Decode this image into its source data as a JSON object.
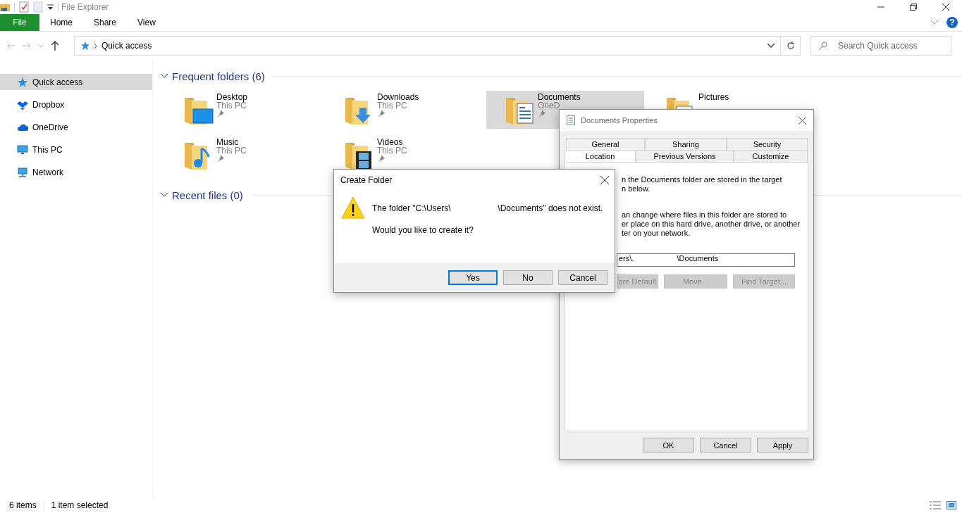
{
  "window": {
    "title": "File Explorer"
  },
  "ribbon": {
    "tabs": [
      {
        "label": "File",
        "kind": "file"
      },
      {
        "label": "Home",
        "kind": "tab"
      },
      {
        "label": "Share",
        "kind": "tab"
      },
      {
        "label": "View",
        "kind": "tab"
      }
    ],
    "help": "?"
  },
  "address": {
    "path": "Quick access"
  },
  "search": {
    "placeholder": "Search Quick access"
  },
  "sidebar": {
    "items": [
      {
        "label": "Quick access",
        "selected": true
      },
      {
        "label": "Dropbox",
        "selected": false
      },
      {
        "label": "OneDrive",
        "selected": false
      },
      {
        "label": "This PC",
        "selected": false
      },
      {
        "label": "Network",
        "selected": false
      }
    ]
  },
  "sections": [
    {
      "title": "Frequent folders (6)",
      "expanded": true,
      "items": [
        {
          "name": "Desktop",
          "location": "This PC",
          "pinned": true,
          "selected": false
        },
        {
          "name": "Downloads",
          "location": "This PC",
          "pinned": true,
          "selected": false
        },
        {
          "name": "Documents",
          "location": "OneD",
          "pinned": true,
          "selected": true
        },
        {
          "name": "Pictures",
          "selected": false
        },
        {
          "name": "Music",
          "location": "This PC",
          "pinned": true,
          "selected": false
        },
        {
          "name": "Videos",
          "location": "This PC",
          "pinned": true,
          "selected": false
        }
      ]
    },
    {
      "title": "Recent files (0)",
      "expanded": true
    }
  ],
  "status_bar": {
    "item_count": "6 items",
    "selection": "1 item selected"
  },
  "properties_dialog": {
    "title": "Documents Properties",
    "tab_rows": [
      [
        {
          "label": "General",
          "selected": false
        },
        {
          "label": "Sharing",
          "selected": false
        },
        {
          "label": "Security",
          "selected": false
        }
      ],
      [
        {
          "label": "Location",
          "selected": true
        },
        {
          "label": "Previous Versions",
          "selected": false
        },
        {
          "label": "Customize",
          "selected": false
        }
      ]
    ],
    "paragraphs": [
      [
        "n the Documents folder are stored in the target",
        "n below."
      ],
      [
        "an change where files in this folder are stored to",
        "er place on this hard drive, another drive, or another",
        "ter on your network."
      ]
    ],
    "path_value": "ers\\.                    \\Documents",
    "actions": [
      {
        "label": "ore Default",
        "disabled": true
      },
      {
        "label": "Move...",
        "disabled": true
      },
      {
        "label": "Find Target...",
        "disabled": true
      }
    ],
    "buttons": [
      {
        "label": "OK"
      },
      {
        "label": "Cancel"
      },
      {
        "label": "Apply"
      }
    ]
  },
  "create_folder_dialog": {
    "title": "Create Folder",
    "message": "The folder \"C:\\Users\\                    \\Documents\" does not exist.",
    "question": "Would you like to create it?",
    "buttons": [
      {
        "label": "Yes",
        "default": true
      },
      {
        "label": "No",
        "default": false
      },
      {
        "label": "Cancel",
        "default": false
      }
    ]
  }
}
